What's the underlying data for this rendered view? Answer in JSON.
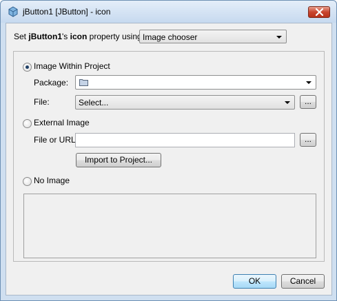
{
  "window": {
    "title": "jButton1 [JButton] - icon"
  },
  "header": {
    "prefix": "Set ",
    "component": "jButton1",
    "possessive": "'s ",
    "property": "icon",
    "suffix": " property using:",
    "mode_selected": "Image chooser"
  },
  "options": {
    "within_project": {
      "label": "Image Within Project",
      "selected": true,
      "package_label": "Package:",
      "package_value": "",
      "file_label": "File:",
      "file_value": "Select...",
      "browse_label": "..."
    },
    "external": {
      "label": "External Image",
      "selected": false,
      "url_label": "File or URL:",
      "url_value": "",
      "browse_label": "...",
      "import_label": "Import to Project..."
    },
    "none": {
      "label": "No Image",
      "selected": false
    }
  },
  "footer": {
    "ok_label": "OK",
    "cancel_label": "Cancel"
  },
  "icons": {
    "title": "netbeans-cube-icon",
    "close": "close-icon",
    "folder": "folder-icon"
  }
}
